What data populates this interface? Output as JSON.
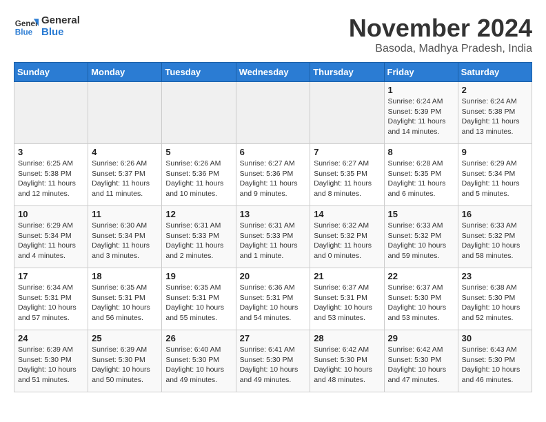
{
  "logo": {
    "line1": "General",
    "line2": "Blue"
  },
  "title": "November 2024",
  "subtitle": "Basoda, Madhya Pradesh, India",
  "weekdays": [
    "Sunday",
    "Monday",
    "Tuesday",
    "Wednesday",
    "Thursday",
    "Friday",
    "Saturday"
  ],
  "weeks": [
    [
      {
        "day": "",
        "info": ""
      },
      {
        "day": "",
        "info": ""
      },
      {
        "day": "",
        "info": ""
      },
      {
        "day": "",
        "info": ""
      },
      {
        "day": "",
        "info": ""
      },
      {
        "day": "1",
        "info": "Sunrise: 6:24 AM\nSunset: 5:39 PM\nDaylight: 11 hours and 14 minutes."
      },
      {
        "day": "2",
        "info": "Sunrise: 6:24 AM\nSunset: 5:38 PM\nDaylight: 11 hours and 13 minutes."
      }
    ],
    [
      {
        "day": "3",
        "info": "Sunrise: 6:25 AM\nSunset: 5:38 PM\nDaylight: 11 hours and 12 minutes."
      },
      {
        "day": "4",
        "info": "Sunrise: 6:26 AM\nSunset: 5:37 PM\nDaylight: 11 hours and 11 minutes."
      },
      {
        "day": "5",
        "info": "Sunrise: 6:26 AM\nSunset: 5:36 PM\nDaylight: 11 hours and 10 minutes."
      },
      {
        "day": "6",
        "info": "Sunrise: 6:27 AM\nSunset: 5:36 PM\nDaylight: 11 hours and 9 minutes."
      },
      {
        "day": "7",
        "info": "Sunrise: 6:27 AM\nSunset: 5:35 PM\nDaylight: 11 hours and 8 minutes."
      },
      {
        "day": "8",
        "info": "Sunrise: 6:28 AM\nSunset: 5:35 PM\nDaylight: 11 hours and 6 minutes."
      },
      {
        "day": "9",
        "info": "Sunrise: 6:29 AM\nSunset: 5:34 PM\nDaylight: 11 hours and 5 minutes."
      }
    ],
    [
      {
        "day": "10",
        "info": "Sunrise: 6:29 AM\nSunset: 5:34 PM\nDaylight: 11 hours and 4 minutes."
      },
      {
        "day": "11",
        "info": "Sunrise: 6:30 AM\nSunset: 5:34 PM\nDaylight: 11 hours and 3 minutes."
      },
      {
        "day": "12",
        "info": "Sunrise: 6:31 AM\nSunset: 5:33 PM\nDaylight: 11 hours and 2 minutes."
      },
      {
        "day": "13",
        "info": "Sunrise: 6:31 AM\nSunset: 5:33 PM\nDaylight: 11 hours and 1 minute."
      },
      {
        "day": "14",
        "info": "Sunrise: 6:32 AM\nSunset: 5:32 PM\nDaylight: 11 hours and 0 minutes."
      },
      {
        "day": "15",
        "info": "Sunrise: 6:33 AM\nSunset: 5:32 PM\nDaylight: 10 hours and 59 minutes."
      },
      {
        "day": "16",
        "info": "Sunrise: 6:33 AM\nSunset: 5:32 PM\nDaylight: 10 hours and 58 minutes."
      }
    ],
    [
      {
        "day": "17",
        "info": "Sunrise: 6:34 AM\nSunset: 5:31 PM\nDaylight: 10 hours and 57 minutes."
      },
      {
        "day": "18",
        "info": "Sunrise: 6:35 AM\nSunset: 5:31 PM\nDaylight: 10 hours and 56 minutes."
      },
      {
        "day": "19",
        "info": "Sunrise: 6:35 AM\nSunset: 5:31 PM\nDaylight: 10 hours and 55 minutes."
      },
      {
        "day": "20",
        "info": "Sunrise: 6:36 AM\nSunset: 5:31 PM\nDaylight: 10 hours and 54 minutes."
      },
      {
        "day": "21",
        "info": "Sunrise: 6:37 AM\nSunset: 5:31 PM\nDaylight: 10 hours and 53 minutes."
      },
      {
        "day": "22",
        "info": "Sunrise: 6:37 AM\nSunset: 5:30 PM\nDaylight: 10 hours and 53 minutes."
      },
      {
        "day": "23",
        "info": "Sunrise: 6:38 AM\nSunset: 5:30 PM\nDaylight: 10 hours and 52 minutes."
      }
    ],
    [
      {
        "day": "24",
        "info": "Sunrise: 6:39 AM\nSunset: 5:30 PM\nDaylight: 10 hours and 51 minutes."
      },
      {
        "day": "25",
        "info": "Sunrise: 6:39 AM\nSunset: 5:30 PM\nDaylight: 10 hours and 50 minutes."
      },
      {
        "day": "26",
        "info": "Sunrise: 6:40 AM\nSunset: 5:30 PM\nDaylight: 10 hours and 49 minutes."
      },
      {
        "day": "27",
        "info": "Sunrise: 6:41 AM\nSunset: 5:30 PM\nDaylight: 10 hours and 49 minutes."
      },
      {
        "day": "28",
        "info": "Sunrise: 6:42 AM\nSunset: 5:30 PM\nDaylight: 10 hours and 48 minutes."
      },
      {
        "day": "29",
        "info": "Sunrise: 6:42 AM\nSunset: 5:30 PM\nDaylight: 10 hours and 47 minutes."
      },
      {
        "day": "30",
        "info": "Sunrise: 6:43 AM\nSunset: 5:30 PM\nDaylight: 10 hours and 46 minutes."
      }
    ]
  ]
}
